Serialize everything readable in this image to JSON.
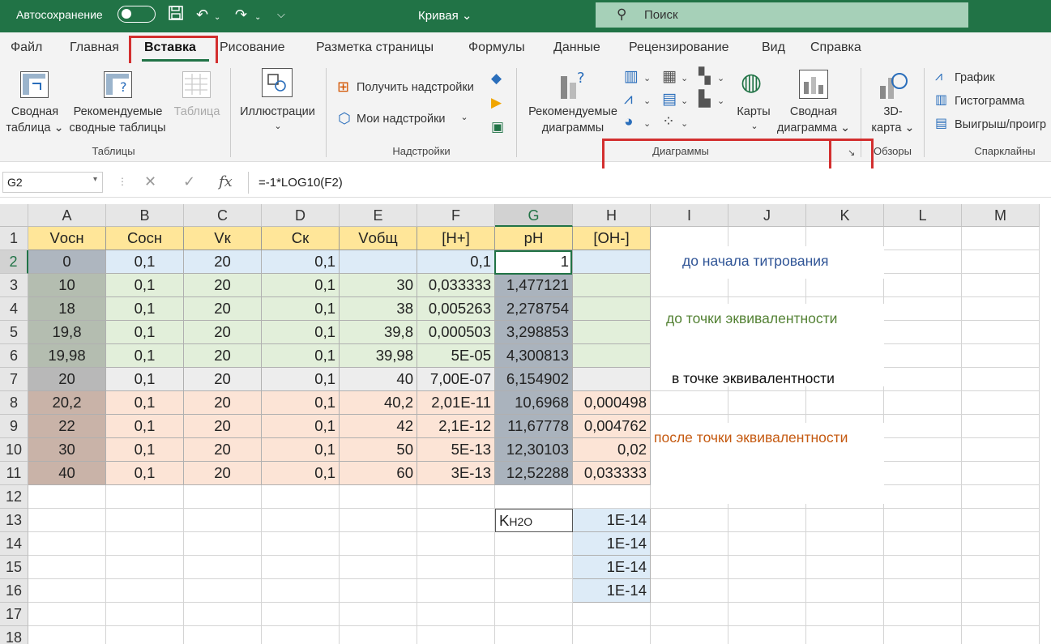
{
  "titlebar": {
    "autosave_label": "Автосохранение",
    "doc_title": "Кривая ⌄",
    "search_placeholder": "Поиск"
  },
  "tabs": [
    "Файл",
    "Главная",
    "Вставка",
    "Рисование",
    "Разметка страницы",
    "Формулы",
    "Данные",
    "Рецензирование",
    "Вид",
    "Справка"
  ],
  "ribbon": {
    "pivot_table": [
      "Сводная",
      "таблица ⌄"
    ],
    "recommended_pivot": [
      "Рекомендуемые",
      "сводные таблицы"
    ],
    "table": "Таблица",
    "illustrations": "Иллюстрации",
    "get_addins": "Получить надстройки",
    "my_addins": "Мои надстройки",
    "recommended_charts": [
      "Рекомендуемые",
      "диаграммы"
    ],
    "maps": "Карты",
    "pivot_chart": [
      "Сводная",
      "диаграмма ⌄"
    ],
    "map3d": [
      "3D-",
      "карта ⌄"
    ],
    "spark_line": "График",
    "spark_column": "Гистограмма",
    "spark_winloss": "Выигрыш/проигр",
    "groups": {
      "tables": "Таблицы",
      "addins": "Надстройки",
      "charts": "Диаграммы",
      "tours": "Обзоры",
      "sparklines": "Спарклайны"
    }
  },
  "formula": {
    "name_box": "G2",
    "content": "=-1*LOG10(F2)"
  },
  "columns": [
    "A",
    "B",
    "C",
    "D",
    "E",
    "F",
    "G",
    "H",
    "I",
    "J",
    "K",
    "L",
    "M"
  ],
  "rows": [
    "1",
    "2",
    "3",
    "4",
    "5",
    "6",
    "7",
    "8",
    "9",
    "10",
    "11",
    "12",
    "13",
    "14",
    "15",
    "16",
    "17",
    "18"
  ],
  "table": {
    "headers": [
      "Vосн",
      "Cосн",
      "Vк",
      "Cк",
      "Vобщ",
      "[H+]",
      "pH",
      "[OH-]"
    ],
    "data": [
      [
        "0",
        "0,1",
        "20",
        "0,1",
        "",
        "0,1",
        "1",
        ""
      ],
      [
        "10",
        "0,1",
        "20",
        "0,1",
        "30",
        "0,033333",
        "1,477121",
        ""
      ],
      [
        "18",
        "0,1",
        "20",
        "0,1",
        "38",
        "0,005263",
        "2,278754",
        ""
      ],
      [
        "19,8",
        "0,1",
        "20",
        "0,1",
        "39,8",
        "0,000503",
        "3,298853",
        ""
      ],
      [
        "19,98",
        "0,1",
        "20",
        "0,1",
        "39,98",
        "5E-05",
        "4,300813",
        ""
      ],
      [
        "20",
        "0,1",
        "20",
        "0,1",
        "40",
        "7,00E-07",
        "6,154902",
        ""
      ],
      [
        "20,2",
        "0,1",
        "20",
        "0,1",
        "40,2",
        "2,01E-11",
        "10,6968",
        "0,000498"
      ],
      [
        "22",
        "0,1",
        "20",
        "0,1",
        "42",
        "2,1E-12",
        "11,67778",
        "0,004762"
      ],
      [
        "30",
        "0,1",
        "20",
        "0,1",
        "50",
        "5E-13",
        "12,30103",
        "0,02"
      ],
      [
        "40",
        "0,1",
        "20",
        "0,1",
        "60",
        "3E-13",
        "12,52288",
        "0,033333"
      ]
    ]
  },
  "kw": {
    "label_main": "K",
    "label_sub": "H2O",
    "values": [
      "1E-14",
      "1E-14",
      "1E-14",
      "1E-14"
    ]
  },
  "notes": {
    "before": "до начала титрования",
    "to_eq": "до точки эквивалентности",
    "at_eq": "в точке эквивалентности",
    "after": "после точки эквивалентности"
  },
  "colors": {
    "excel_green": "#217346",
    "header_yellow": "#ffe699",
    "blue_row": "#ddebf7",
    "green_rows": "#e2efda",
    "gray_row": "#ededed",
    "orange_rows": "#fce4d6",
    "highlight_red": "#d32f2f"
  }
}
